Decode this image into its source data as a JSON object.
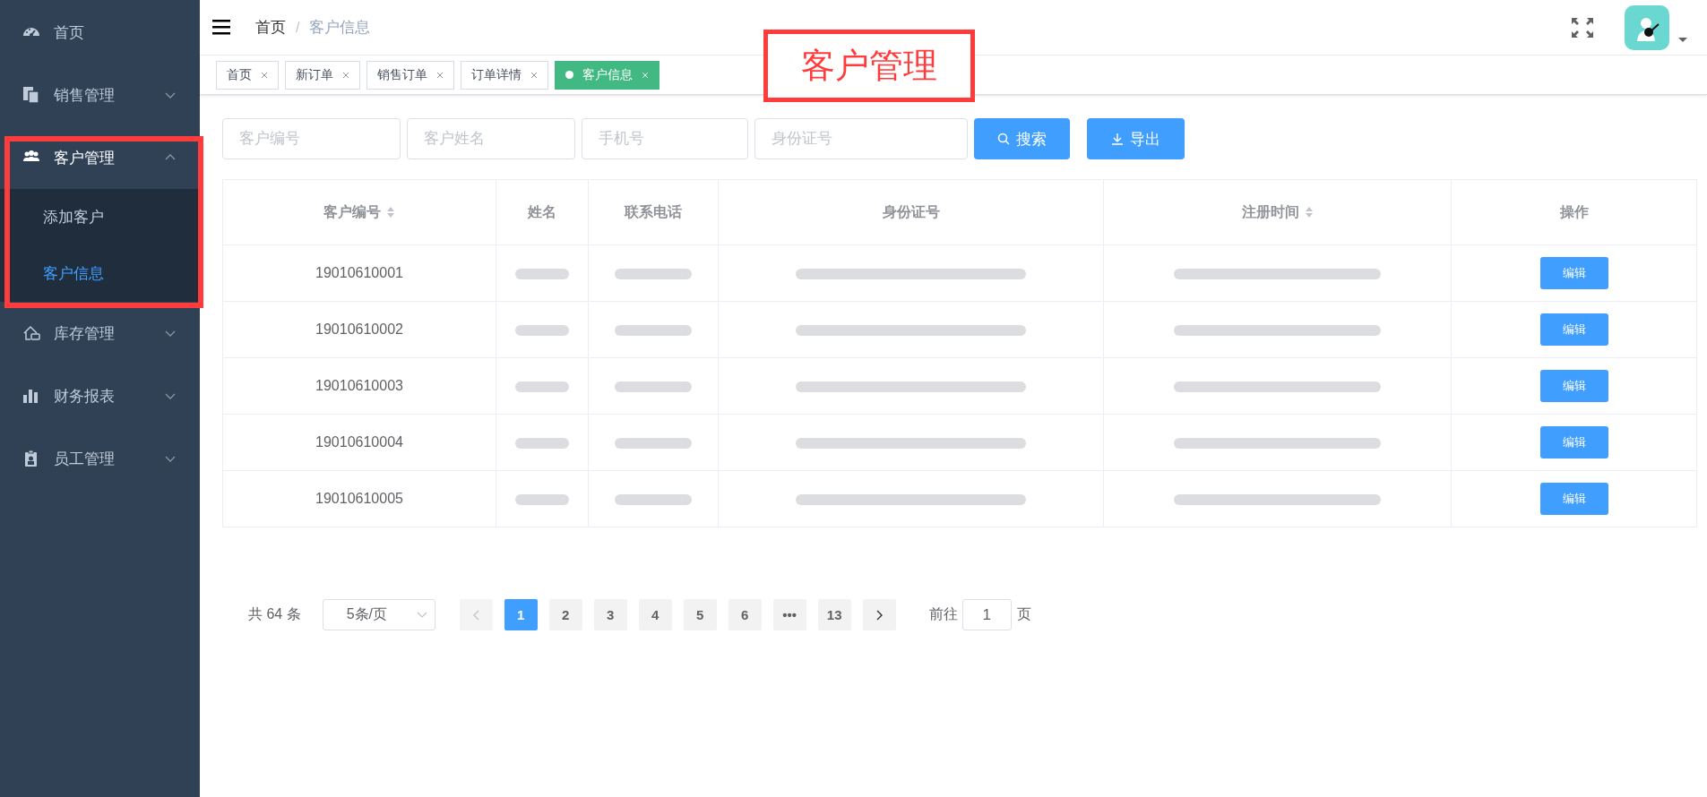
{
  "sidebar": {
    "items": [
      {
        "label": "首页"
      },
      {
        "label": "销售管理",
        "expanded": false
      },
      {
        "label": "客户管理",
        "expanded": true,
        "children": [
          {
            "label": "添加客户",
            "selected": false
          },
          {
            "label": "客户信息",
            "selected": true
          }
        ]
      },
      {
        "label": "库存管理",
        "expanded": false
      },
      {
        "label": "财务报表",
        "expanded": false
      },
      {
        "label": "员工管理",
        "expanded": false
      }
    ]
  },
  "breadcrumb": {
    "items": [
      "首页",
      "客户信息"
    ],
    "separators": [
      "/"
    ]
  },
  "tags": [
    {
      "label": "首页",
      "selected": false
    },
    {
      "label": "新订单",
      "selected": false
    },
    {
      "label": "销售订单",
      "selected": false
    },
    {
      "label": "订单详情",
      "selected": false
    },
    {
      "label": "客户信息",
      "selected": true
    }
  ],
  "filters": [
    {
      "placeholder": "客户编号"
    },
    {
      "placeholder": "客户姓名"
    },
    {
      "placeholder": "手机号"
    },
    {
      "placeholder": "身份证号"
    }
  ],
  "buttons": [
    {
      "label": "搜索",
      "kind": "search"
    },
    {
      "label": "导出",
      "kind": "export"
    }
  ],
  "table": {
    "columns": [
      {
        "label": "客户编号",
        "sortable": true
      },
      {
        "label": "姓名",
        "sortable": false
      },
      {
        "label": "联系电话",
        "sortable": false
      },
      {
        "label": "身份证号",
        "sortable": false
      },
      {
        "label": "注册时间",
        "sortable": true
      },
      {
        "label": "操作",
        "sortable": false
      }
    ],
    "rows": [
      {
        "cells": [
          {
            "kind": "text",
            "text": "19010610001"
          },
          {
            "kind": "redacted"
          },
          {
            "kind": "redacted"
          },
          {
            "kind": "redacted"
          },
          {
            "kind": "redacted"
          },
          {
            "kind": "button",
            "text": "编辑"
          }
        ]
      },
      {
        "cells": [
          {
            "kind": "text",
            "text": "19010610002"
          },
          {
            "kind": "redacted"
          },
          {
            "kind": "redacted"
          },
          {
            "kind": "redacted"
          },
          {
            "kind": "redacted"
          },
          {
            "kind": "button",
            "text": "编辑"
          }
        ]
      },
      {
        "cells": [
          {
            "kind": "text",
            "text": "19010610003"
          },
          {
            "kind": "redacted"
          },
          {
            "kind": "redacted"
          },
          {
            "kind": "redacted"
          },
          {
            "kind": "redacted"
          },
          {
            "kind": "button",
            "text": "编辑"
          }
        ]
      },
      {
        "cells": [
          {
            "kind": "text",
            "text": "19010610004"
          },
          {
            "kind": "redacted"
          },
          {
            "kind": "redacted"
          },
          {
            "kind": "redacted"
          },
          {
            "kind": "redacted"
          },
          {
            "kind": "button",
            "text": "编辑"
          }
        ]
      },
      {
        "cells": [
          {
            "kind": "text",
            "text": "19010610005"
          },
          {
            "kind": "redacted"
          },
          {
            "kind": "redacted"
          },
          {
            "kind": "redacted"
          },
          {
            "kind": "redacted"
          },
          {
            "kind": "button",
            "text": "编辑"
          }
        ]
      }
    ]
  },
  "pagination": {
    "total": "共 64 条",
    "page_size": "5条/页",
    "prev_disabled": true,
    "pages": [
      {
        "label": "1",
        "selected": true
      },
      {
        "label": "2",
        "selected": false
      },
      {
        "label": "3",
        "selected": false
      },
      {
        "label": "4",
        "selected": false
      },
      {
        "label": "5",
        "selected": false
      },
      {
        "label": "6",
        "selected": false
      },
      {
        "label": "•••",
        "selected": false
      },
      {
        "label": "13",
        "selected": false
      }
    ],
    "goto_label": "前往",
    "goto_value": "1",
    "goto_unit": "页"
  },
  "annotations": [
    {
      "kind": "label",
      "text": "客户管理"
    },
    {
      "kind": "frame"
    }
  ]
}
